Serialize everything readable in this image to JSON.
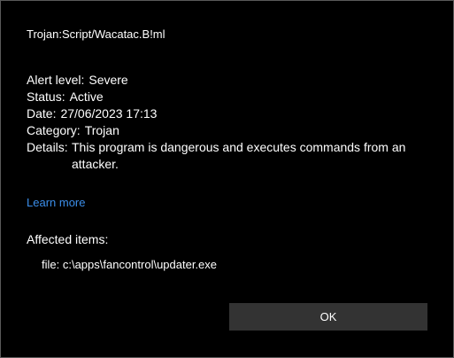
{
  "threat": {
    "name": "Trojan:Script/Wacatac.B!ml"
  },
  "details": {
    "alert_level_label": "Alert level:",
    "alert_level_value": "Severe",
    "status_label": "Status:",
    "status_value": "Active",
    "date_label": "Date:",
    "date_value": "27/06/2023 17:13",
    "category_label": "Category:",
    "category_value": "Trojan",
    "details_label": "Details:",
    "details_value": "This program is dangerous and executes commands from an attacker."
  },
  "links": {
    "learn_more": "Learn more",
    "link_color": "#3b8eea"
  },
  "affected": {
    "heading": "Affected items:",
    "items": [
      "file: c:\\apps\\fancontrol\\updater.exe"
    ]
  },
  "actions": {
    "ok_label": "OK"
  },
  "colors": {
    "background": "#000000",
    "text": "#ffffff",
    "button": "#333333",
    "border": "#5a5a5a"
  }
}
